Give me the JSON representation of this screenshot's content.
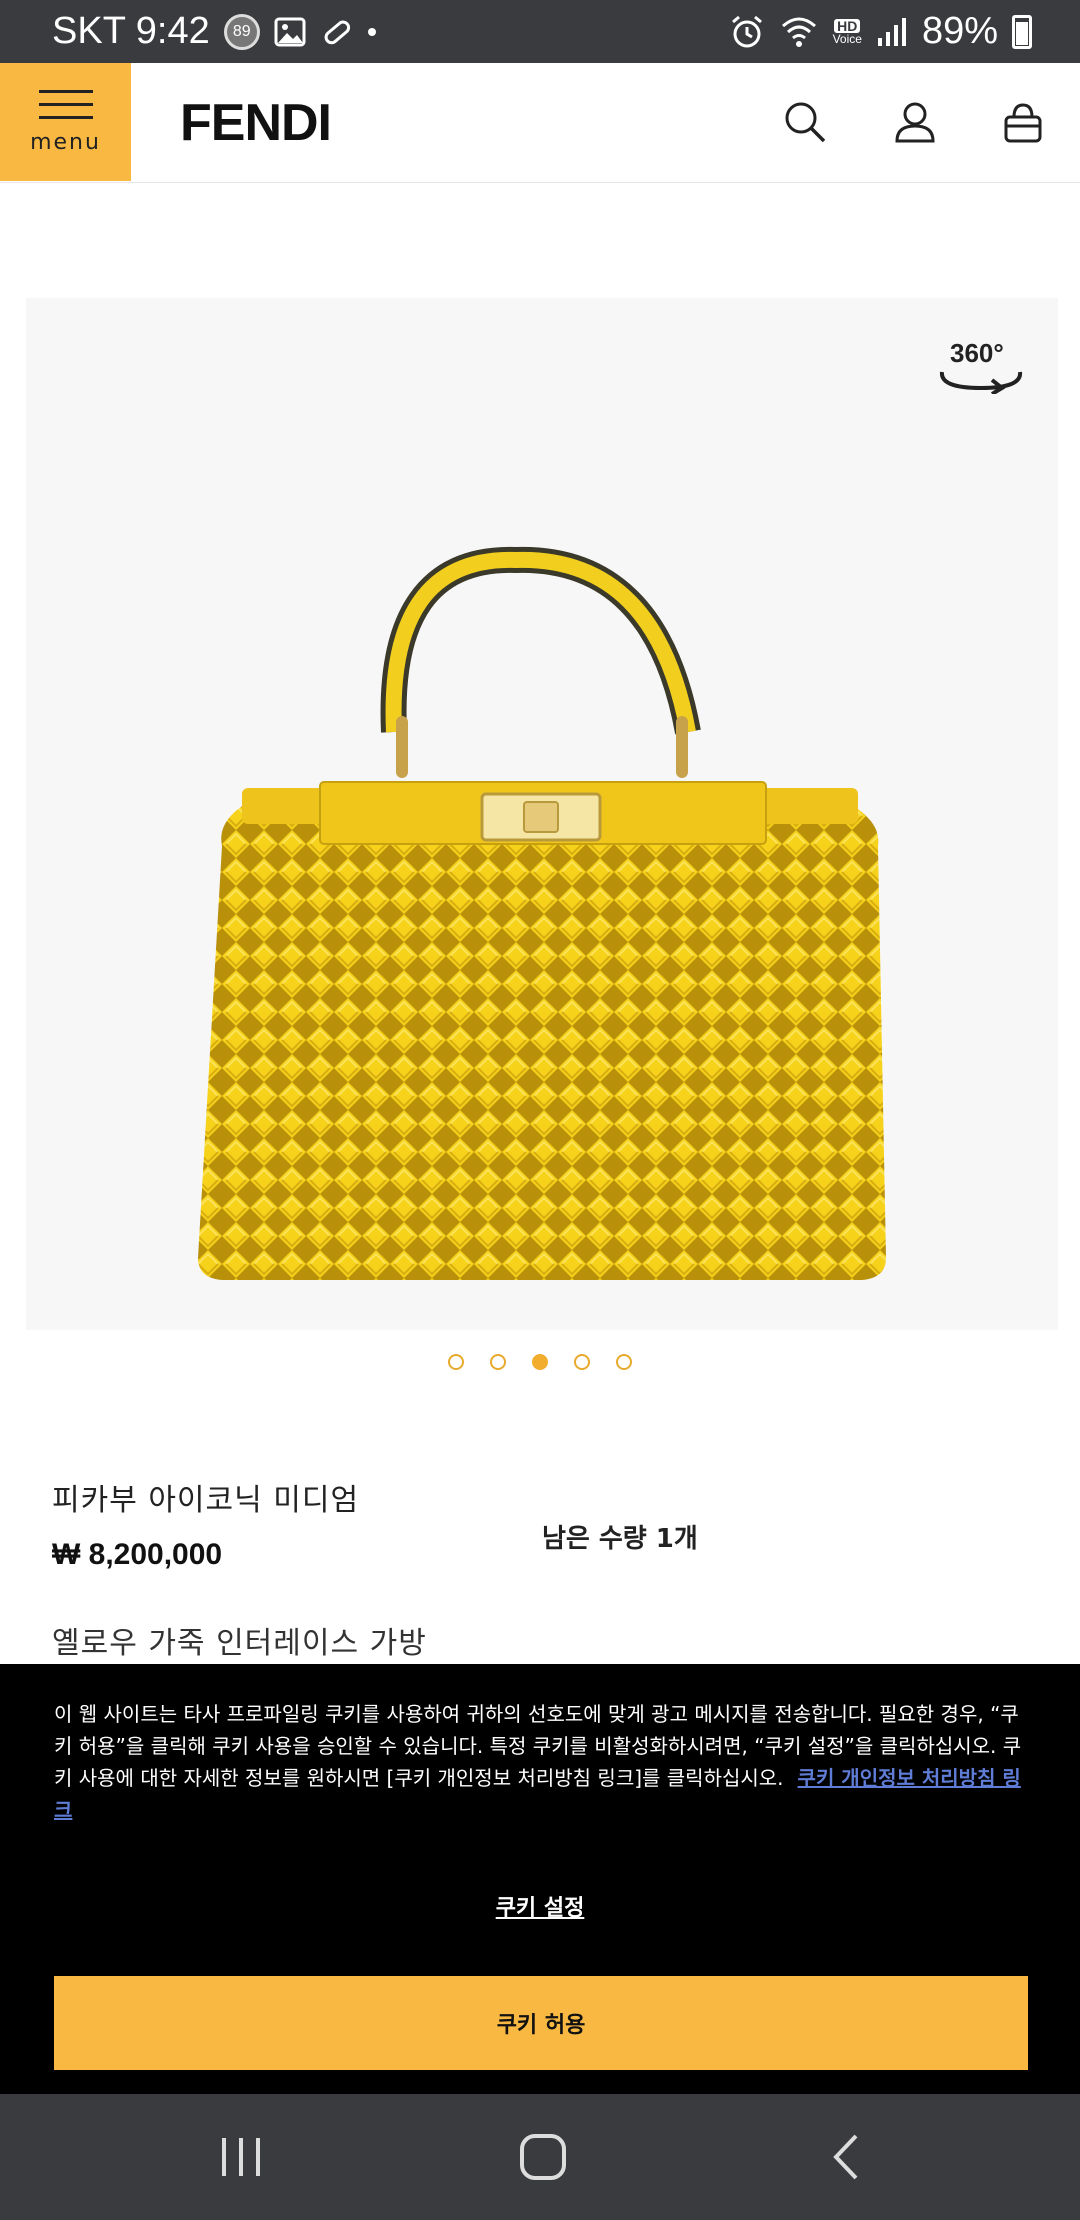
{
  "status_bar": {
    "carrier_time": "SKT 9:42",
    "notification_badge": "89",
    "hd_label": "HD",
    "voice_label": "Voice",
    "battery": "89%"
  },
  "header": {
    "menu_label": "menu",
    "logo": "FENDI"
  },
  "gallery": {
    "badge_360": "360°",
    "total_slides": 5,
    "active_slide": 3
  },
  "product": {
    "name": "피카부 아이코닉 미디엄",
    "price": "₩ 8,200,000",
    "stock": "남은 수량 1개",
    "description": "옐로우 가죽 인터레이스 가방"
  },
  "cookie": {
    "text": "이 웹 사이트는 타사 프로파일링 쿠키를 사용하여 귀하의 선호도에 맞게 광고 메시지를 전송합니다. 필요한 경우, “쿠키 허용”을 클릭해 쿠키 사용을 승인할 수 있습니다. 특정 쿠키를 비활성화하시려면, “쿠키 설정”을 클릭하십시오. 쿠키 사용에 대한 자세한 정보를 원하시면 [쿠키 개인정보 처리방침 링크]를 클릭하십시오.",
    "link_label": "쿠키 개인정보 처리방침 링크",
    "settings_label": "쿠키 설정",
    "accept_label": "쿠키 허용"
  },
  "colors": {
    "accent": "#f8b842",
    "bag_yellow": "#f5d020",
    "status_bar": "#3a3b3f"
  }
}
